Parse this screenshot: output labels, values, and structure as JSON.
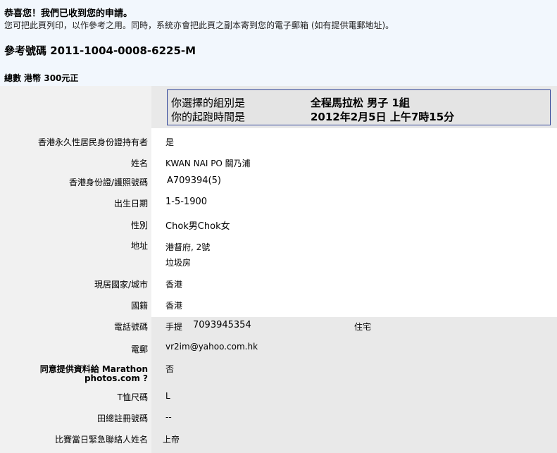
{
  "header": {
    "congrats": "恭喜您！我們已收到您的申請。",
    "note": "您可把此頁列印，以作參考之用。同時，系統亦會把此頁之副本寄到您的電子郵箱 (如有提供電郵地址)。",
    "reference": "參考號碼 2011-1004-0008-6225-M",
    "total": "總數 港幣 300元正"
  },
  "selection": {
    "group_label": "你選擇的組別是",
    "group_value": "全程馬拉松 男子 1組",
    "start_label": "你的起跑時間是",
    "start_value": "2012年2月5日  上午7時15分"
  },
  "fields": {
    "permanent_resident": {
      "label": "香港永久性居民身份證持有者",
      "value": "是"
    },
    "name": {
      "label": "姓名",
      "value": "KWAN NAI PO 關乃浦"
    },
    "id_number": {
      "label": "香港身份證/護照號碼",
      "value": "A709394(5)"
    },
    "dob": {
      "label": "出生日期",
      "value": "1-5-1900"
    },
    "gender": {
      "label": "性別",
      "value": "Chok男Chok女"
    },
    "address": {
      "label": "地址",
      "line1": "港督府, 2號",
      "line2": "垃圾房"
    },
    "residence": {
      "label": "現居國家/城市",
      "value": "香港"
    },
    "nationality": {
      "label": "國籍",
      "value": "香港"
    },
    "phone": {
      "label": "電話號碼",
      "mobile_label": "手提",
      "mobile_value": "7093945354",
      "home_label": "住宅"
    },
    "email": {
      "label": "電郵",
      "value": "vr2im@yahoo.com.hk"
    },
    "consent": {
      "label_line1": "同意提供資料給 Marathon",
      "label_line2": "photos.com ?",
      "value": "否"
    },
    "tshirt": {
      "label": "T恤尺碼",
      "value": "L"
    },
    "athletics_reg": {
      "label": "田總註冊號碼",
      "value": "--"
    },
    "emergency_contact": {
      "label": "比賽當日緊急聯絡人姓名",
      "value": "上帝"
    }
  }
}
